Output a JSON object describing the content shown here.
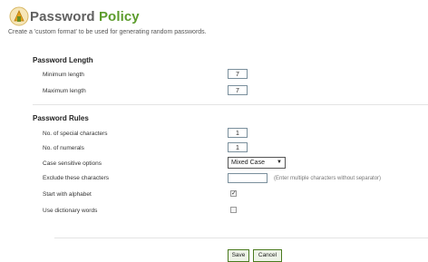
{
  "header": {
    "title_part1": "Password",
    "title_part2": "Policy",
    "subtitle": "Create a 'custom format' to be used for generating random passwords."
  },
  "password_length": {
    "heading": "Password Length",
    "minimum_label": "Minimum length",
    "minimum_value": "7",
    "maximum_label": "Maximum length",
    "maximum_value": "7"
  },
  "password_rules": {
    "heading": "Password Rules",
    "special_label": "No. of special characters",
    "special_value": "1",
    "numerals_label": "No. of numerals",
    "numerals_value": "1",
    "case_label": "Case sensitive options",
    "case_value": "Mixed Case",
    "exclude_label": "Exclude these characters",
    "exclude_value": "",
    "exclude_hint": "(Enter multiple characters without separator)",
    "alphabet_label": "Start with alphabet",
    "alphabet_checked": true,
    "dictionary_label": "Use dictionary words",
    "dictionary_checked": false
  },
  "buttons": {
    "save": "Save",
    "cancel": "Cancel"
  },
  "colors": {
    "title_green": "#5c9c2c",
    "button_border": "#4a7a1e"
  }
}
